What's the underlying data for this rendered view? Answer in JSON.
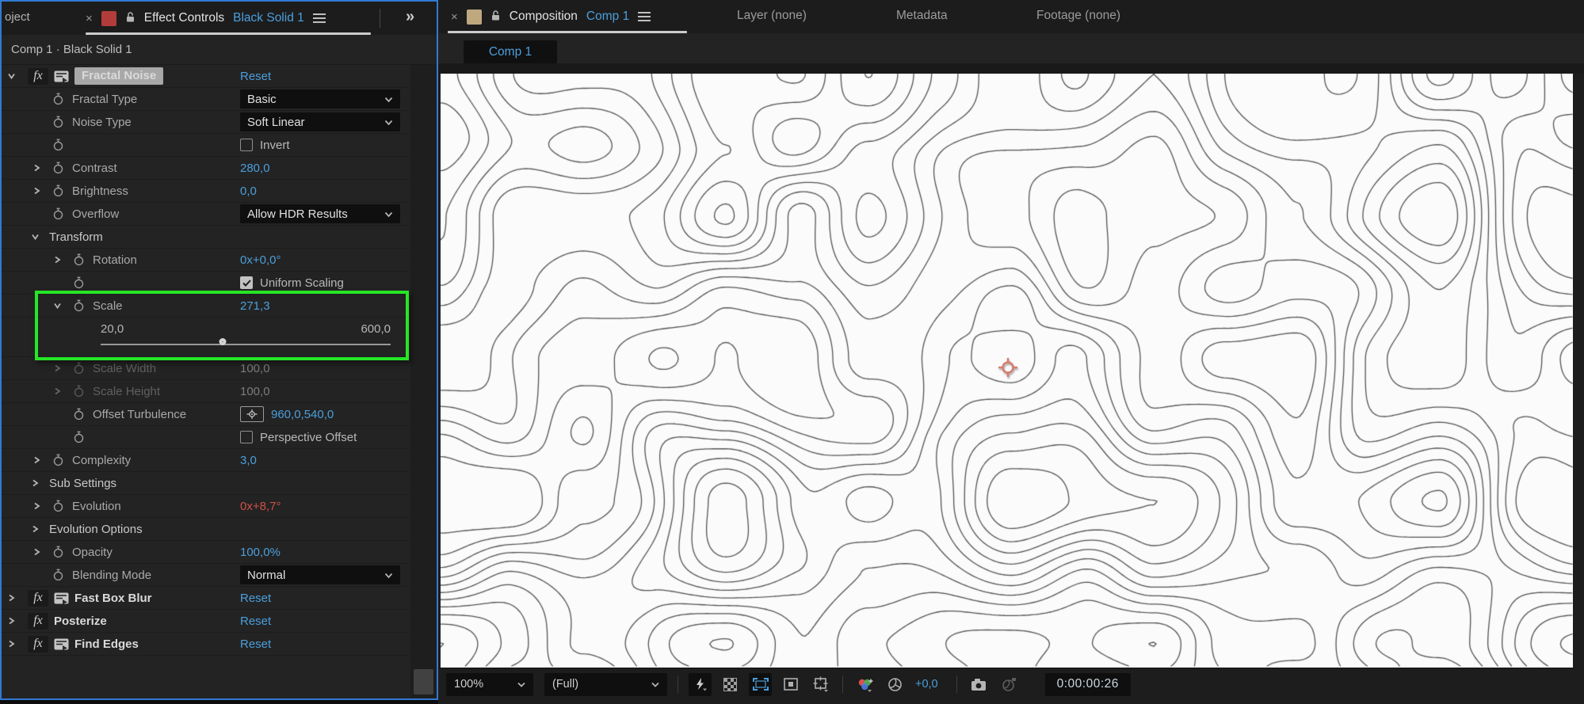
{
  "colors": {
    "accent_blue": "#4b9fdc",
    "value_red": "#d05045",
    "annotation_green": "#26e626",
    "active_panel_border": "#3279d2",
    "layer_swatch_red": "#b23c3a",
    "comp_swatch_tan": "#bfa87e"
  },
  "left_panel": {
    "project_tab_label": "oject",
    "tab": {
      "close": "×",
      "title": "Effect Controls",
      "target": "Black Solid 1",
      "menu": "≡"
    },
    "more_tabs": "»",
    "breadcrumb": "Comp 1 · Black Solid 1",
    "rows": [
      {
        "type": "effect",
        "expander": "down",
        "icon": true,
        "label": "Fractal Noise",
        "selected": true,
        "control": "reset",
        "value": "Reset"
      },
      {
        "type": "prop",
        "ind": 1,
        "stopwatch": true,
        "label": "Fractal Type",
        "control": "dropdown",
        "value": "Basic"
      },
      {
        "type": "prop",
        "ind": 1,
        "stopwatch": true,
        "label": "Noise Type",
        "control": "dropdown",
        "value": "Soft Linear"
      },
      {
        "type": "prop",
        "ind": 1,
        "stopwatch": true,
        "label": "",
        "control": "checkbox",
        "checked": false,
        "value": "Invert"
      },
      {
        "type": "prop",
        "ind": 1,
        "expander": "right",
        "stopwatch": true,
        "label": "Contrast",
        "control": "value",
        "value": "280,0",
        "vcolor": "blue"
      },
      {
        "type": "prop",
        "ind": 1,
        "expander": "right",
        "stopwatch": true,
        "label": "Brightness",
        "control": "value",
        "value": "0,0",
        "vcolor": "blue"
      },
      {
        "type": "prop",
        "ind": 1,
        "stopwatch": true,
        "label": "Overflow",
        "control": "dropdown",
        "value": "Allow HDR Results"
      },
      {
        "type": "group",
        "expander": "down",
        "label": "Transform"
      },
      {
        "type": "prop",
        "ind": 2,
        "expander": "right",
        "stopwatch": true,
        "label": "Rotation",
        "control": "value",
        "value": "0x+0,0°",
        "vcolor": "blue"
      },
      {
        "type": "prop",
        "ind": 2,
        "stopwatch": true,
        "label": "",
        "control": "checkbox",
        "checked": true,
        "value": "Uniform Scaling"
      },
      {
        "type": "prop",
        "ind": 2,
        "expander": "down",
        "stopwatch": true,
        "label": "Scale",
        "control": "value",
        "value": "271,3",
        "vcolor": "blue"
      },
      {
        "type": "slider",
        "min": "20,0",
        "max": "600,0",
        "pos": 0.42
      },
      {
        "type": "prop",
        "ind": 2,
        "expander": "right",
        "stopwatch": true,
        "disabled": true,
        "label": "Scale Width",
        "control": "value",
        "value": "100,0",
        "vcolor": "dim"
      },
      {
        "type": "prop",
        "ind": 2,
        "expander": "right",
        "stopwatch": true,
        "disabled": true,
        "label": "Scale Height",
        "control": "value",
        "value": "100,0",
        "vcolor": "dim"
      },
      {
        "type": "prop",
        "ind": 2,
        "stopwatch": true,
        "label": "Offset Turbulence",
        "control": "point",
        "value": "960,0,540,0",
        "vcolor": "blue"
      },
      {
        "type": "prop",
        "ind": 2,
        "stopwatch": true,
        "label": "",
        "control": "checkbox",
        "checked": false,
        "value": "Perspective Offset"
      },
      {
        "type": "prop",
        "ind": 1,
        "expander": "right",
        "stopwatch": true,
        "label": "Complexity",
        "control": "value",
        "value": "3,0",
        "vcolor": "blue"
      },
      {
        "type": "group",
        "expander": "right",
        "label": "Sub Settings"
      },
      {
        "type": "prop",
        "ind": 1,
        "expander": "right",
        "stopwatch": true,
        "label": "Evolution",
        "control": "value",
        "value": "0x+8,7°",
        "vcolor": "red"
      },
      {
        "type": "group",
        "expander": "right",
        "label": "Evolution Options"
      },
      {
        "type": "prop",
        "ind": 1,
        "expander": "right",
        "stopwatch": true,
        "label": "Opacity",
        "control": "value",
        "value": "100,0%",
        "vcolor": "blue"
      },
      {
        "type": "prop",
        "ind": 1,
        "stopwatch": true,
        "label": "Blending Mode",
        "control": "dropdown",
        "value": "Normal"
      },
      {
        "type": "effect",
        "expander": "right",
        "icon": true,
        "label": "Fast Box Blur",
        "control": "reset",
        "value": "Reset"
      },
      {
        "type": "effect",
        "expander": "right",
        "icon": false,
        "label": "Posterize",
        "control": "reset",
        "value": "Reset"
      },
      {
        "type": "effect",
        "expander": "right",
        "icon": true,
        "label": "Find Edges",
        "control": "reset",
        "value": "Reset"
      }
    ]
  },
  "right_panel": {
    "tab": {
      "close": "×",
      "title": "Composition",
      "target": "Comp 1",
      "menu": "≡"
    },
    "other_tabs": {
      "layer": "Layer (none)",
      "metadata": "Metadata",
      "footage": "Footage (none)"
    },
    "comp_tab_label": "Comp 1",
    "toolbar": {
      "zoom": "100%",
      "resolution": "(Full)",
      "exposure_value": "+0,0",
      "timecode": "0:00:00:26",
      "icons": [
        "fast-preview",
        "transparency-grid",
        "region-of-interest",
        "mask-and-shape-paths",
        "view-options",
        "show-channels",
        "reset-exposure",
        "snapshot",
        "show-snapshot"
      ]
    }
  }
}
